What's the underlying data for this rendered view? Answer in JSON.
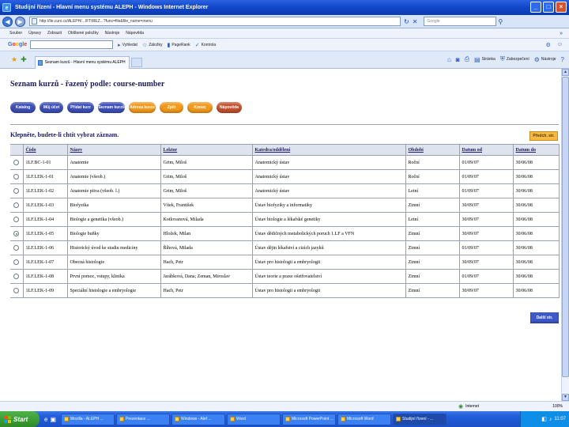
{
  "browser": {
    "window_title": "Studijní řízení - Hlavní menu systému ALEPH - Windows Internet Explorer",
    "url": "http://ile.cuni.cz/ALEPH/...IFTtREZ...?func=file&file_name=menu",
    "search_placeholder": "Google",
    "menu": [
      "Soubor",
      "Úpravy",
      "Zobrazit",
      "Oblíbené položky",
      "Nástroje",
      "Nápověda"
    ],
    "google_label": "Google",
    "google_tools": [
      "Vyhledat",
      "Záložky",
      "PageRank",
      "Kontrola"
    ],
    "tab_label": "Seznam kurzů - Hlavní menu systému ALEPH",
    "commands": [
      "Stránka",
      "Zabezpečení",
      "Nástroje"
    ],
    "status_zone": "Internet",
    "status_zoom": "100%"
  },
  "page": {
    "title": "Seznam kurzů - řazený podle: course-number",
    "buttons": [
      {
        "label": "Katalog",
        "style": "blue"
      },
      {
        "label": "Můj účet",
        "style": "blue"
      },
      {
        "label": "Přidat kurz",
        "style": "blue"
      },
      {
        "label": "Seznam kurzů",
        "style": "blue"
      },
      {
        "label": "Adresa kurzu",
        "style": "orange"
      },
      {
        "label": "Zpět",
        "style": "orange"
      },
      {
        "label": "Konec",
        "style": "orange"
      },
      {
        "label": "Nápověda",
        "style": "red"
      }
    ],
    "instruction": "Klepněte, budete-li chtít vybrat záznam.",
    "prev_button": "Předch. str.",
    "next_button": "Další str.",
    "table": {
      "headers": [
        "Číslo",
        "Název",
        "Lektor",
        "Katedra/oddělení",
        "Období",
        "Datum od",
        "Datum do"
      ],
      "rows": [
        {
          "selected": false,
          "cells": [
            "1LF.BC-1-01",
            "Anatomie",
            "Grim, Miloš",
            "Anatomický ústav",
            "Roční",
            "01/09/07",
            "30/06/08"
          ]
        },
        {
          "selected": false,
          "cells": [
            "1LF.LEK-1-01",
            "Anatomie (všeob.)",
            "Grim, Miloš",
            "Anatomický ústav",
            "Roční",
            "01/09/07",
            "30/06/08"
          ]
        },
        {
          "selected": false,
          "cells": [
            "1LF.LEK-1-02",
            "Anatomie pitva (všeob. l.)",
            "Grim, Miloš",
            "Anatomický ústav",
            "Letní",
            "01/09/07",
            "30/06/08"
          ]
        },
        {
          "selected": false,
          "cells": [
            "1LF.LEK-1-03",
            "Biofyzika",
            "Vítek, František",
            "Ústav biofyziky a informatiky",
            "Zimní",
            "30/09/07",
            "30/06/08"
          ]
        },
        {
          "selected": false,
          "cells": [
            "1LF.LEK-1-04",
            "Biologie a genetika (všeob.)",
            "Kotlovanová, Milada",
            "Ústav biologie a lékařské genetiky",
            "Letní",
            "30/09/07",
            "30/06/08"
          ]
        },
        {
          "selected": true,
          "cells": [
            "1LF.LEK-1-05",
            "Biologie buňky",
            "Hložek, Milan",
            "Ústav dědičných metabolických poruch 1.LF a VFN",
            "Zimní",
            "30/09/07",
            "30/06/08"
          ]
        },
        {
          "selected": false,
          "cells": [
            "1LF.LEK-1-06",
            "Historický úvod ke studiu medicíny",
            "Říhová, Milada",
            "Ústav dějin lékařství a cizích jazyků",
            "Zimní",
            "01/09/07",
            "30/06/08"
          ]
        },
        {
          "selected": false,
          "cells": [
            "1LF.LEK-1-07",
            "Obecná histologie",
            "Hach, Petr",
            "Ústav pro histologii a embryologii",
            "Zimní",
            "30/09/07",
            "30/06/08"
          ]
        },
        {
          "selected": false,
          "cells": [
            "1LF.LEK-1-08",
            "První pomoc, vstupy, klinika",
            "Jarábková, Dana; Zeman, Miroslav",
            "Ústav teorie a praxe ošetřovatelství",
            "Zimní",
            "01/09/07",
            "30/06/08"
          ]
        },
        {
          "selected": false,
          "cells": [
            "1LF.LEK-1-09",
            "Speciální histologie a embryologie",
            "Hach, Petr",
            "Ústav pro histologii a embryologii",
            "Zimní",
            "30/09/07",
            "30/06/08"
          ]
        }
      ]
    }
  },
  "taskbar": {
    "start_label": "Start",
    "tasks": [
      {
        "label": "Mozilla - ALEPH ...",
        "active": false
      },
      {
        "label": "Prezentace ...",
        "active": false
      },
      {
        "label": "Windows - Alef ...",
        "active": false
      },
      {
        "label": "Word",
        "active": false
      },
      {
        "label": "Microsoft PowerPoint ...",
        "active": false
      },
      {
        "label": "Microsoft Word",
        "active": false
      },
      {
        "label": "Studijní řízení - ...",
        "active": true
      }
    ],
    "clock": "11:07"
  },
  "colors": {
    "title_blue": "#1b1b5e",
    "button_blue": "#3d4fb8",
    "button_orange": "#f39a1c",
    "button_red": "#c4502e",
    "header_bg": "#dfe3ee"
  }
}
